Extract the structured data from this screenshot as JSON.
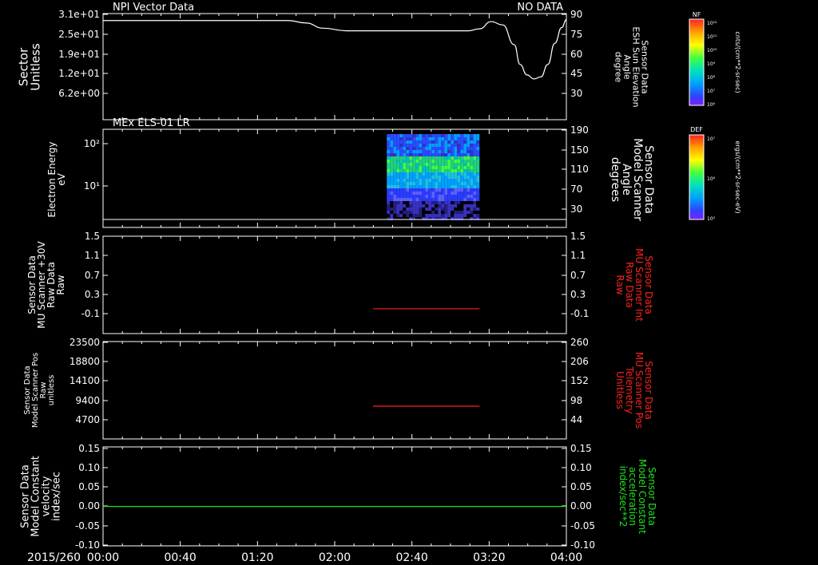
{
  "chart_data": [
    {
      "type": "line",
      "title": "NPI Vector Data",
      "status": "NO DATA",
      "ylabel_left": [
        "Sector",
        "Unitless"
      ],
      "ylabel_right": [
        "Sensor Data",
        "ESH Sun Elevation",
        "Angle",
        "degree"
      ],
      "left_ticks": [
        "3.1e+01",
        "2.5e+01",
        "1.9e+01",
        "1.2e+01",
        "6.2e+00"
      ],
      "right_ticks": [
        "90",
        "75",
        "60",
        "45",
        "30"
      ],
      "ylim_right": [
        15,
        90
      ],
      "series": [
        {
          "color": "#ffffff",
          "x": [
            0,
            1.6,
            1.75,
            1.9,
            2.1,
            2.5,
            2.95,
            3.15,
            3.25,
            3.35,
            3.45,
            3.55,
            3.6,
            3.66,
            3.72,
            3.78,
            3.84,
            3.9,
            3.96,
            4.0
          ],
          "y": [
            85.3,
            85.3,
            83.5,
            79.5,
            77.5,
            77.5,
            77.5,
            77.5,
            79.0,
            84.5,
            82.0,
            67.0,
            52.0,
            44.0,
            41.0,
            42.5,
            52.0,
            68.0,
            80.0,
            86.0
          ]
        }
      ]
    },
    {
      "type": "heatmap",
      "title": "MEx ELS-01 LR",
      "ylabel_left": [
        "Electron Energy",
        "eV"
      ],
      "ylabel_right": [
        "Sensor Data",
        "Model Scanner",
        "Angle",
        "degrees"
      ],
      "left_ticks": [
        "10²",
        "10¹"
      ],
      "right_ticks": [
        "190",
        "150",
        "110",
        "70",
        "30"
      ],
      "ylim_right": [
        0,
        190
      ],
      "x_extent": [
        2.45,
        3.25
      ],
      "baseline_y": 10,
      "colorbar": {
        "label": "DEF",
        "units": "ergs/(cm**2-sr-sec-eV)",
        "ticks": [
          "10⁷",
          "10⁶",
          "10⁵"
        ]
      }
    },
    {
      "type": "line",
      "ylabel_left": [
        "Sensor Data",
        "MU Scanner +30V",
        "Raw Data",
        "Raw"
      ],
      "ylabel_right": [
        "Sensor Data",
        "MU Scanner Int",
        "Raw Data",
        "Raw"
      ],
      "left_ticks": [
        "1.5",
        "1.1",
        "0.7",
        "0.3",
        "-0.1"
      ],
      "right_ticks": [
        "1.5",
        "1.1",
        "0.7",
        "0.3",
        "-0.1"
      ],
      "ylim": [
        -0.5,
        1.5
      ],
      "series": [
        {
          "color": "#ff2020",
          "x": [
            2.33,
            3.25
          ],
          "y": [
            0.0,
            0.0
          ]
        }
      ]
    },
    {
      "type": "line",
      "ylabel_left": [
        "Sensor Data",
        "Model Scanner Pos",
        "Raw",
        "unitless"
      ],
      "ylabel_right": [
        "Sensor Data",
        "MU Scanner Pos",
        "Telemetry",
        "Unitless"
      ],
      "left_ticks": [
        "23500",
        "18800",
        "14100",
        "9400",
        "4700"
      ],
      "right_ticks": [
        "260",
        "206",
        "152",
        "98",
        "44"
      ],
      "ylim": [
        0,
        23500
      ],
      "series": [
        {
          "color": "#ff2020",
          "x": [
            2.33,
            3.25
          ],
          "y": [
            8000,
            8000
          ]
        }
      ]
    },
    {
      "type": "line",
      "ylabel_left": [
        "Sensor Data",
        "Model Constant",
        "velocity",
        "index/sec"
      ],
      "ylabel_right": [
        "Sensor Data",
        "Model Constant",
        "acceleration",
        "index/sec**2"
      ],
      "left_ticks": [
        "0.15",
        "0.10",
        "0.05",
        "0.00",
        "-0.05",
        "-0.10"
      ],
      "right_ticks": [
        "0.15",
        "0.10",
        "0.05",
        "0.00",
        "-0.05",
        "-0.10"
      ],
      "ylim": [
        -0.1,
        0.15
      ],
      "series": [
        {
          "color": "#20e020",
          "x": [
            0,
            4
          ],
          "y": [
            0,
            0
          ]
        }
      ]
    }
  ],
  "colorbar_top": {
    "label": "NF",
    "units": "cnts/(cm**2-sr-sec)",
    "ticks": [
      "10¹²",
      "10¹¹",
      "10¹⁰",
      "10⁹",
      "10⁸",
      "10⁷",
      "10⁶"
    ]
  },
  "x_axis": {
    "date": "2015/260",
    "ticks": [
      "00:00",
      "00:40",
      "01:20",
      "02:00",
      "02:40",
      "03:20",
      "04:00"
    ],
    "xlim": [
      0,
      4
    ]
  },
  "colors": {
    "left_label": "#ffffff",
    "right_red": "#ff2020",
    "right_green": "#20e020"
  }
}
